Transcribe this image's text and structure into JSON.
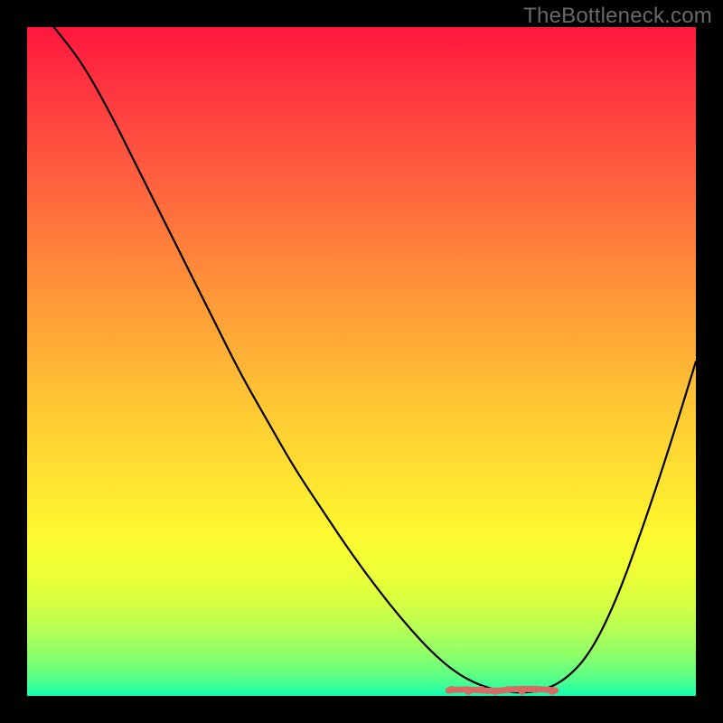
{
  "watermark": "TheBottleneck.com",
  "colors": {
    "frame": "#000000",
    "curve": "#000000",
    "marker": "#d96a63",
    "gradient_top": "#ff173e",
    "gradient_bottom": "#0effb4"
  },
  "chart_data": {
    "type": "line",
    "title": "",
    "xlabel": "",
    "ylabel": "",
    "xlim": [
      0,
      100
    ],
    "ylim": [
      0,
      100
    ],
    "x": [
      4,
      8,
      12,
      16,
      20,
      24,
      28,
      32,
      36,
      40,
      44,
      48,
      52,
      56,
      60,
      64,
      68,
      72,
      76,
      80,
      84,
      88,
      92,
      96,
      100
    ],
    "values": [
      100,
      95,
      88,
      80,
      72,
      64,
      56,
      48,
      41,
      34,
      28,
      22,
      16.5,
      11.5,
      7,
      3.5,
      1.4,
      0.5,
      0.5,
      2,
      6,
      14,
      25,
      37,
      50
    ],
    "optimal_range_x": [
      63,
      79
    ],
    "optimal_marker_x": [
      63.5,
      66,
      68,
      70,
      72,
      74,
      76,
      78.5
    ],
    "notes": "V-shaped bottleneck curve over rainbow background; minimum (optimal) region highlighted with salmon bar/dots near x≈63–79."
  }
}
